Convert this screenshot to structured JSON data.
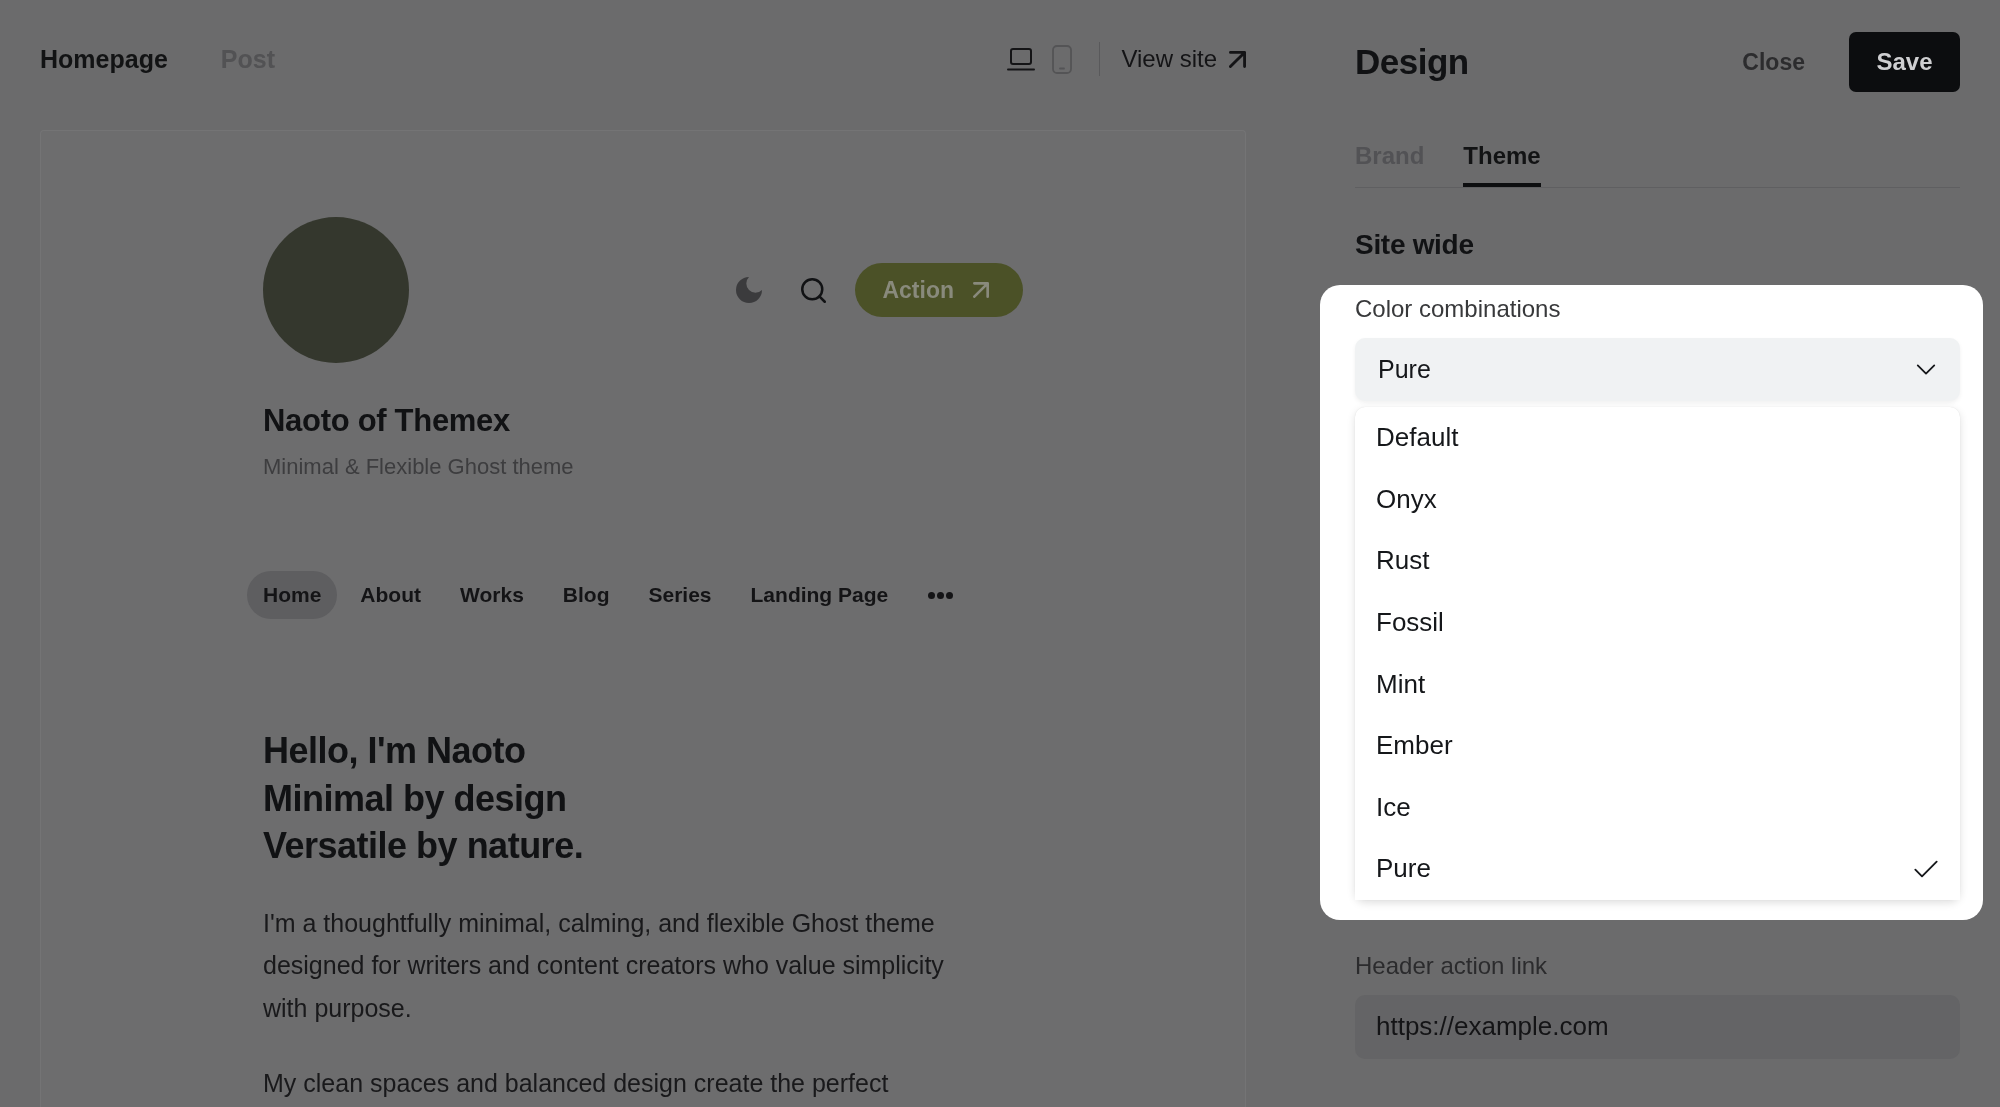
{
  "preview_toolbar": {
    "tabs": [
      {
        "label": "Homepage",
        "selected": true
      },
      {
        "label": "Post",
        "selected": false
      }
    ],
    "devices": [
      {
        "kind": "desktop",
        "selected": true
      },
      {
        "kind": "mobile",
        "selected": false
      }
    ],
    "view_site": "View site"
  },
  "preview": {
    "site_title": "Naoto of Themex",
    "site_description": "Minimal & Flexible Ghost theme",
    "action_button": "Action",
    "nav": [
      {
        "label": "Home",
        "selected": true
      },
      {
        "label": "About",
        "selected": false
      },
      {
        "label": "Works",
        "selected": false
      },
      {
        "label": "Blog",
        "selected": false
      },
      {
        "label": "Series",
        "selected": false
      },
      {
        "label": "Landing Page",
        "selected": false
      }
    ],
    "headline": [
      "Hello, I'm Naoto",
      "Minimal by design",
      "Versatile by nature."
    ],
    "paragraphs": [
      "I'm a thoughtfully minimal, calming, and flexible Ghost theme designed for writers and content creators who value simplicity with purpose.",
      "My clean spaces and balanced design create the perfect"
    ]
  },
  "panel": {
    "title": "Design",
    "close_button": "Close",
    "save_button": "Save",
    "tabs": [
      {
        "label": "Brand",
        "selected": false
      },
      {
        "label": "Theme",
        "selected": true
      }
    ],
    "section_title": "Site wide",
    "color_combinations": {
      "label": "Color combinations",
      "value": "Pure",
      "expanded": true,
      "options": [
        {
          "label": "Default",
          "selected": false
        },
        {
          "label": "Onyx",
          "selected": false
        },
        {
          "label": "Rust",
          "selected": false
        },
        {
          "label": "Fossil",
          "selected": false
        },
        {
          "label": "Mint",
          "selected": false
        },
        {
          "label": "Ember",
          "selected": false
        },
        {
          "label": "Ice",
          "selected": false
        },
        {
          "label": "Pure",
          "selected": true
        }
      ]
    },
    "header_action_link": {
      "label": "Header action link",
      "value": "https://example.com"
    }
  }
}
